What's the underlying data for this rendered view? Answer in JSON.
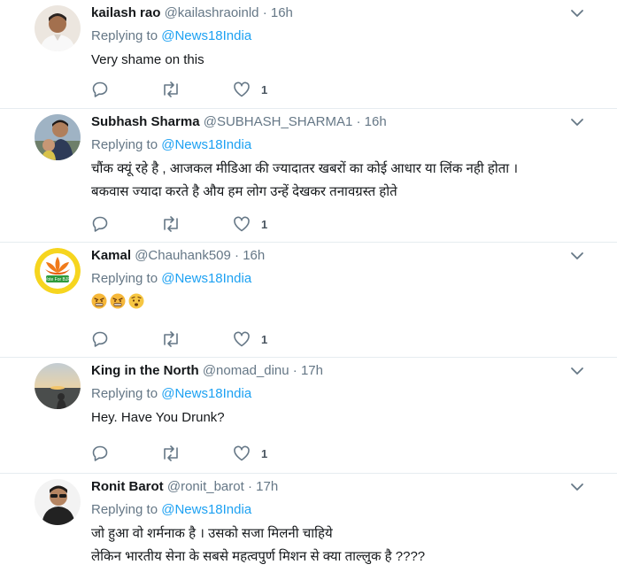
{
  "tweets": [
    {
      "name": "kailash rao",
      "handle": "@kailashraoinld",
      "sep": "·",
      "time": "16h",
      "replying_prefix": "Replying to",
      "replying_to": "@News18India",
      "text_lines": [
        "Very shame on this"
      ],
      "likes": "1",
      "avatar": "man-in-white-shirt"
    },
    {
      "name": "Subhash Sharma",
      "handle": "@SUBHASH_SHARMA1",
      "sep": "·",
      "time": "16h",
      "replying_prefix": "Replying to",
      "replying_to": "@News18India",
      "text_lines": [
        "चौंक क्यूं रहे है , आजकल मीडिआ की ज्यादातर खबरों का कोई आधार या लिंक नही होता ।",
        "बकवास ज्यादा करते है औय हम लोग उन्हें देखकर तनावग्रस्त होते"
      ],
      "likes": "1",
      "avatar": "man-with-child"
    },
    {
      "name": "Kamal",
      "handle": "@Chauhank509",
      "sep": "·",
      "time": "16h",
      "replying_prefix": "Replying to",
      "replying_to": "@News18India",
      "text_lines": [
        ""
      ],
      "emojis": [
        "angry-face",
        "angry-face",
        "worried-face"
      ],
      "likes": "1",
      "avatar": "bjp-lotus-logo",
      "avatar_logo_text": "Vote For BJP"
    },
    {
      "name": "King in the North",
      "handle": "@nomad_dinu",
      "sep": "·",
      "time": "17h",
      "replying_prefix": "Replying to",
      "replying_to": "@News18India",
      "text_lines": [
        "Hey. Have You Drunk?"
      ],
      "likes": "1",
      "avatar": "sunset-landscape"
    },
    {
      "name": "Ronit Barot",
      "handle": "@ronit_barot",
      "sep": "·",
      "time": "17h",
      "replying_prefix": "Replying to",
      "replying_to": "@News18India",
      "text_lines": [
        "जो हुआ वो शर्मनाक है । उसको सजा मिलनी चाहिये",
        "लेकिन भारतीय सेना के सबसे महत्वपुर्ण मिशन से क्या ताल्लुक है ????"
      ],
      "avatar": "man-with-sunglasses"
    }
  ],
  "colors": {
    "link": "#1da1f2",
    "muted": "#657786",
    "border": "#e6ecf0"
  },
  "icons": {
    "reply": "reply-icon",
    "retweet": "retweet-icon",
    "like": "heart-icon",
    "menu": "chevron-down-icon"
  }
}
